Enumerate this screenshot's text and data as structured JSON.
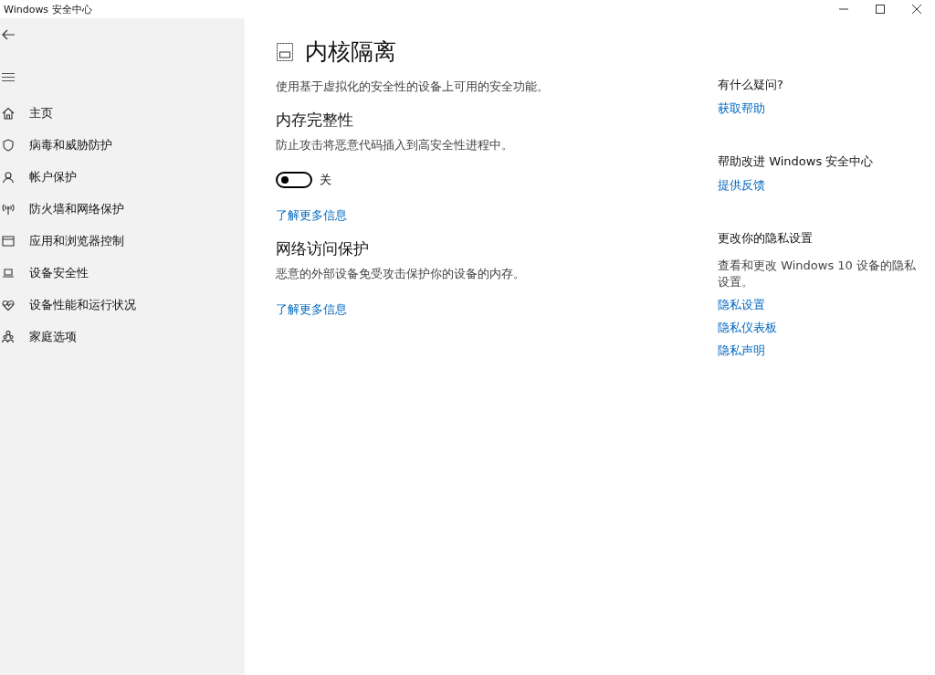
{
  "window": {
    "title": "Windows 安全中心"
  },
  "sidebar": {
    "items": [
      {
        "label": "主页"
      },
      {
        "label": "病毒和威胁防护"
      },
      {
        "label": "帐户保护"
      },
      {
        "label": "防火墙和网络保护"
      },
      {
        "label": "应用和浏览器控制"
      },
      {
        "label": "设备安全性"
      },
      {
        "label": "设备性能和运行状况"
      },
      {
        "label": "家庭选项"
      }
    ]
  },
  "page": {
    "title": "内核隔离",
    "description": "使用基于虚拟化的安全性的设备上可用的安全功能。",
    "sections": [
      {
        "heading": "内存完整性",
        "description": "防止攻击将恶意代码插入到高安全性进程中。",
        "toggle": {
          "on": false,
          "label": "关"
        },
        "link": "了解更多信息"
      },
      {
        "heading": "网络访问保护",
        "description": "恶意的外部设备免受攻击保护你的设备的内存。",
        "link": "了解更多信息"
      }
    ]
  },
  "aside": [
    {
      "heading": "有什么疑问?",
      "links": [
        "获取帮助"
      ]
    },
    {
      "heading": "帮助改进 Windows 安全中心",
      "links": [
        "提供反馈"
      ]
    },
    {
      "heading": "更改你的隐私设置",
      "description": "查看和更改 Windows 10 设备的隐私设置。",
      "links": [
        "隐私设置",
        "隐私仪表板",
        "隐私声明"
      ]
    }
  ]
}
